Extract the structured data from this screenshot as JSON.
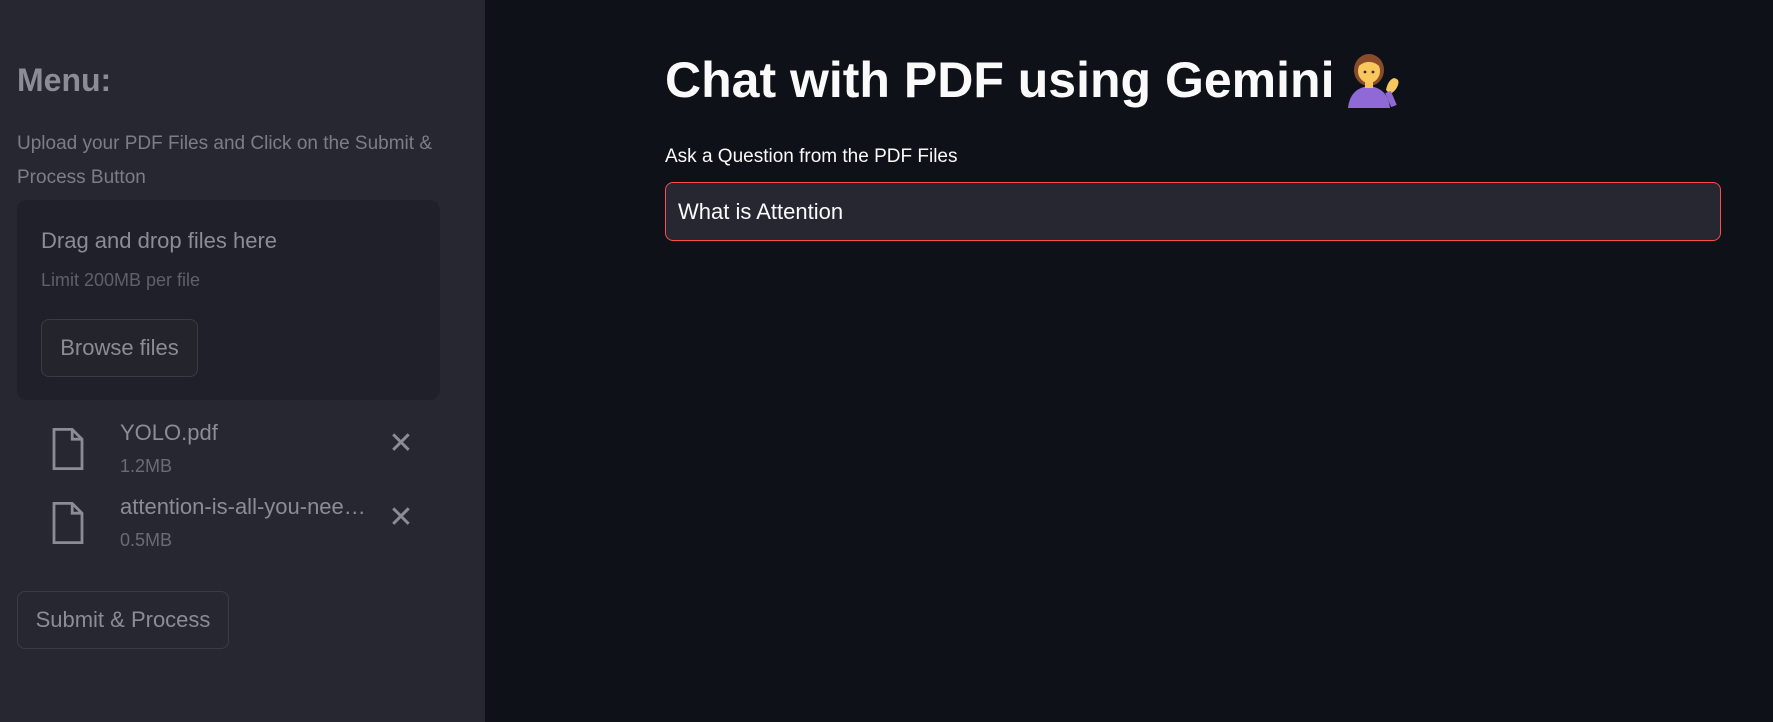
{
  "sidebar": {
    "menu_title": "Menu:",
    "upload_label": "Upload your PDF Files and Click on the Submit & Process Button",
    "dropzone": {
      "title": "Drag and drop files here",
      "limit": "Limit 200MB per file",
      "browse_label": "Browse files"
    },
    "files": [
      {
        "name": "YOLO.pdf",
        "size": "1.2MB"
      },
      {
        "name": "attention-is-all-you-nee…",
        "size": "0.5MB"
      }
    ],
    "submit_label": "Submit & Process"
  },
  "main": {
    "title": "Chat with PDF using Gemini",
    "title_emoji": "person-tipping-hand-icon",
    "question_label": "Ask a Question from the PDF Files",
    "question_value": "What is Attention"
  },
  "colors": {
    "main_bg": "#0e1117",
    "sidebar_bg": "#262730",
    "input_border": "#ff4b4b",
    "text_primary": "#fafafa"
  }
}
